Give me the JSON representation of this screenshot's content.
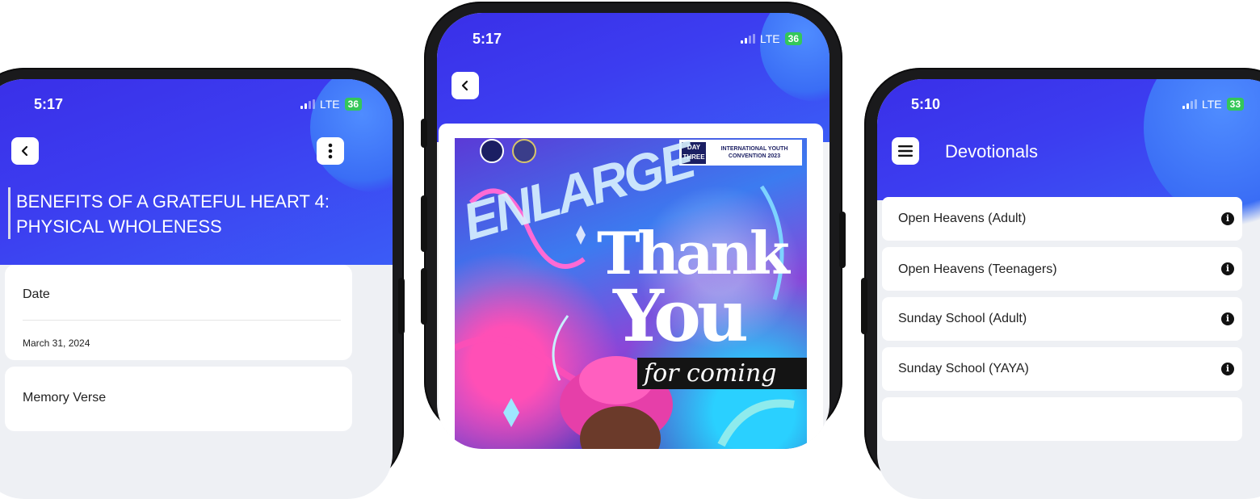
{
  "phone_left": {
    "status_time": "5:17",
    "network": "LTE",
    "battery": "36",
    "title": "BENEFITS OF A GRATEFUL HEART 4: PHYSICAL WHOLENESS",
    "date_label": "Date",
    "date_value": "March 31, 2024",
    "memory_verse_label": "Memory Verse",
    "icons": [
      "back-icon",
      "more-vertical-icon"
    ]
  },
  "phone_center": {
    "status_time": "5:17",
    "network": "LTE",
    "battery": "36",
    "poster": {
      "badge_day": "DAY THREE",
      "badge_text": "INTERNATIONAL YOUTH CONVENTION 2023",
      "word_top": "ENLARGE",
      "word_thank": "Thank",
      "word_you": "You",
      "word_script": "for coming"
    }
  },
  "phone_right": {
    "status_time": "5:10",
    "network": "LTE",
    "battery": "33",
    "title": "Devotionals",
    "items": [
      {
        "label": "Open Heavens (Adult)"
      },
      {
        "label": "Open Heavens (Teenagers)"
      },
      {
        "label": "Sunday School (Adult)"
      },
      {
        "label": "Sunday School (YAYA)"
      }
    ]
  },
  "colors": {
    "header_blue": "#3a3cf0",
    "battery_green": "#34c759",
    "poster_pink": "#e63fa9",
    "poster_navy": "#1b1f63"
  }
}
